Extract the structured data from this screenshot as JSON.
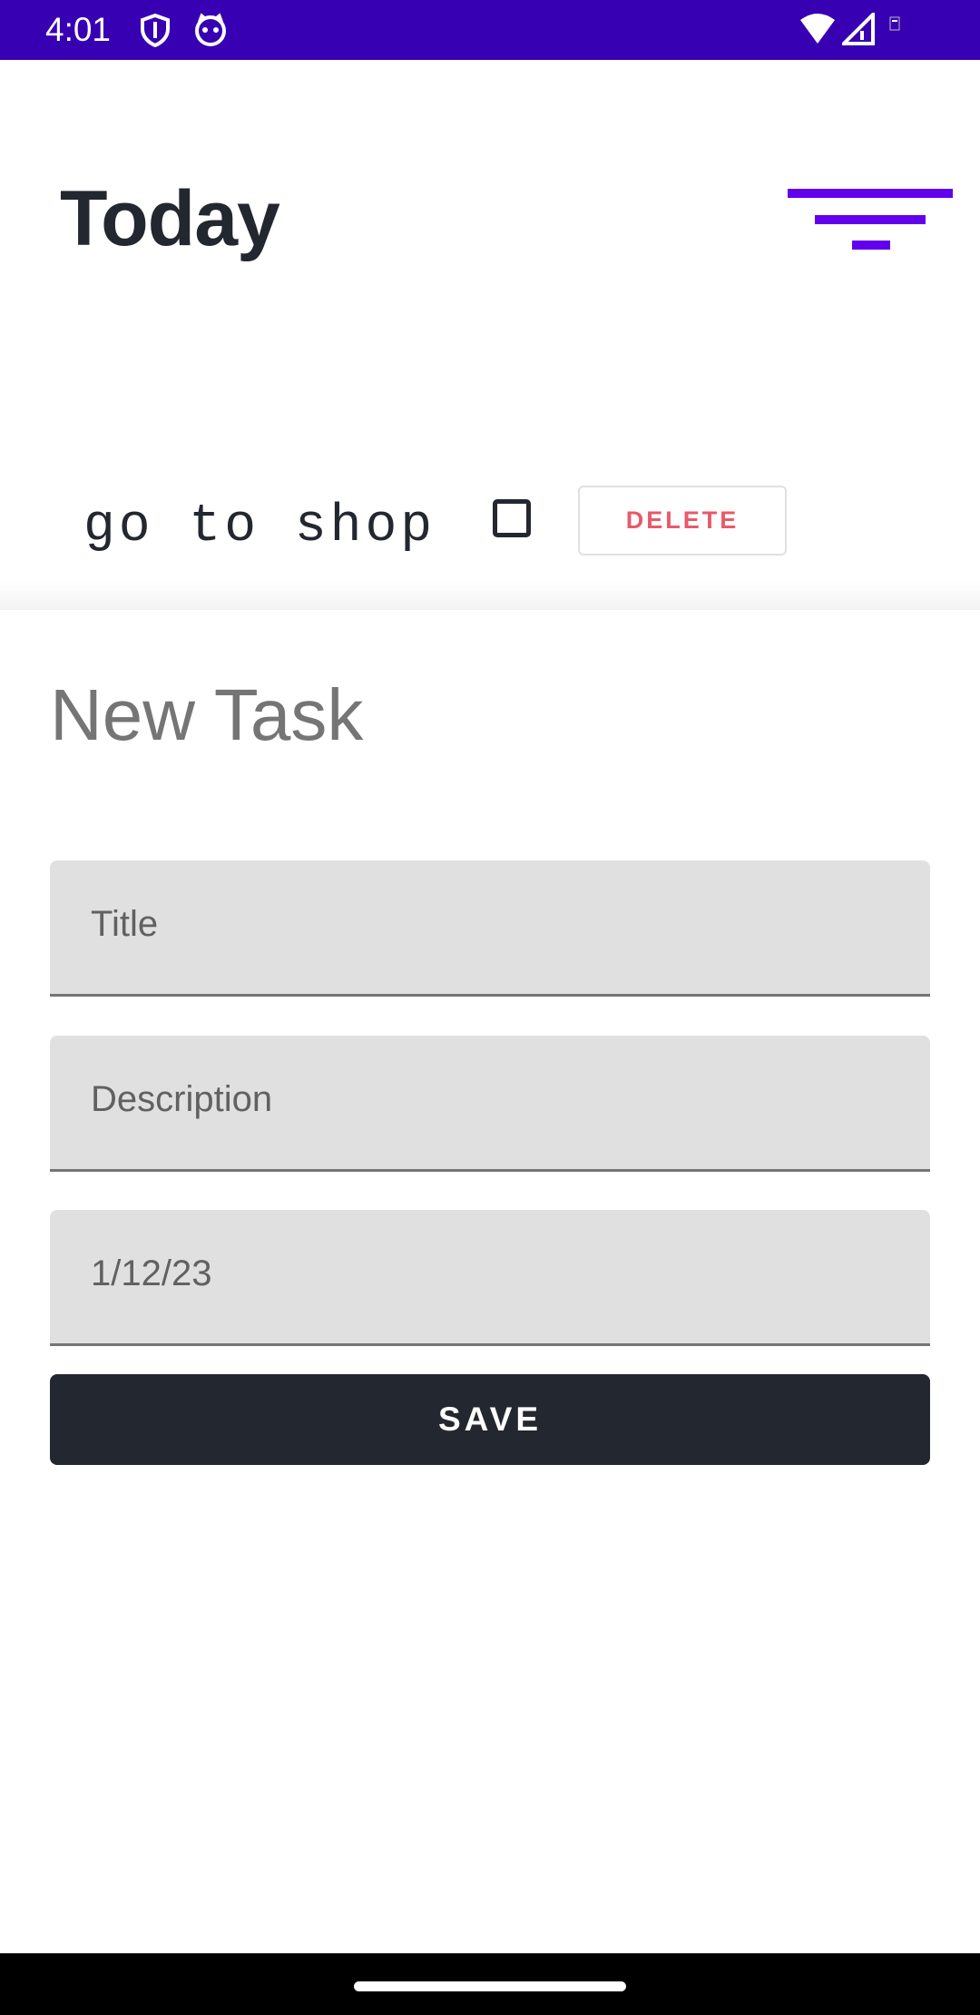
{
  "status_bar": {
    "time": "4:01",
    "icons": [
      "shield-icon",
      "cat-face-icon",
      "wifi-icon",
      "cell-signal-icon",
      "battery-icon"
    ],
    "background": "#3700b3"
  },
  "header": {
    "title": "Today",
    "filter_icon": "filter-list-icon",
    "accent": "#6200ee"
  },
  "tasks": [
    {
      "title": "go to shop",
      "checked": false,
      "delete_label": "DELETE"
    }
  ],
  "new_task_sheet": {
    "title": "New Task",
    "fields": {
      "title_placeholder": "Title",
      "description_placeholder": "Description",
      "date_value": "1/12/23"
    },
    "save_label": "SAVE"
  },
  "colors": {
    "text_dark": "#23272f",
    "delete_text": "#e85a6a",
    "field_bg": "#e0e0e0"
  }
}
